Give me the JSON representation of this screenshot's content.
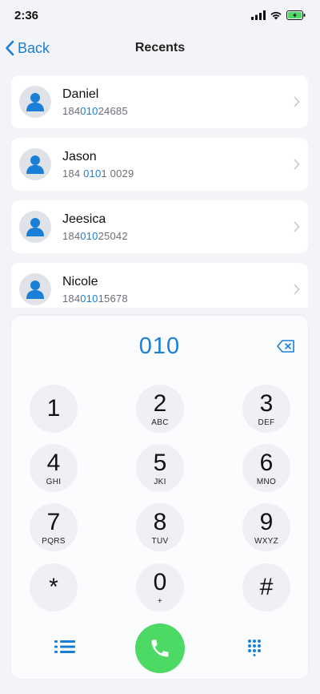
{
  "status_bar": {
    "time": "2:36"
  },
  "nav": {
    "back_label": "Back",
    "title": "Recents"
  },
  "recents": [
    {
      "name": "Daniel",
      "number_pre": "184",
      "number_match": "010",
      "number_post": "24685"
    },
    {
      "name": "Jason",
      "number_pre": "184 ",
      "number_match": "010",
      "number_post": "1 0029"
    },
    {
      "name": "Jeesica",
      "number_pre": "184",
      "number_match": "010",
      "number_post": "25042"
    },
    {
      "name": "Nicole",
      "number_pre": "184",
      "number_match": "010",
      "number_post": "15678"
    }
  ],
  "dialpad": {
    "display": "010",
    "keys": [
      {
        "digit": "1",
        "letters": ""
      },
      {
        "digit": "2",
        "letters": "ABC"
      },
      {
        "digit": "3",
        "letters": "DEF"
      },
      {
        "digit": "4",
        "letters": "GHI"
      },
      {
        "digit": "5",
        "letters": "JKI"
      },
      {
        "digit": "6",
        "letters": "MNO"
      },
      {
        "digit": "7",
        "letters": "PQRS"
      },
      {
        "digit": "8",
        "letters": "TUV"
      },
      {
        "digit": "9",
        "letters": "WXYZ"
      },
      {
        "digit": "*",
        "letters": ""
      },
      {
        "digit": "0",
        "letters": "+"
      },
      {
        "digit": "#",
        "letters": ""
      }
    ]
  },
  "icons": {
    "back": "chevron-left-icon",
    "avatar": "person-icon",
    "row_chevron": "chevron-right-icon",
    "backspace": "backspace-icon",
    "call": "phone-icon",
    "list": "list-icon",
    "keypad": "keypad-grid-icon"
  },
  "colors": {
    "accent": "#1a7fd6",
    "call": "#4cd964",
    "battery": "#4cd964"
  }
}
